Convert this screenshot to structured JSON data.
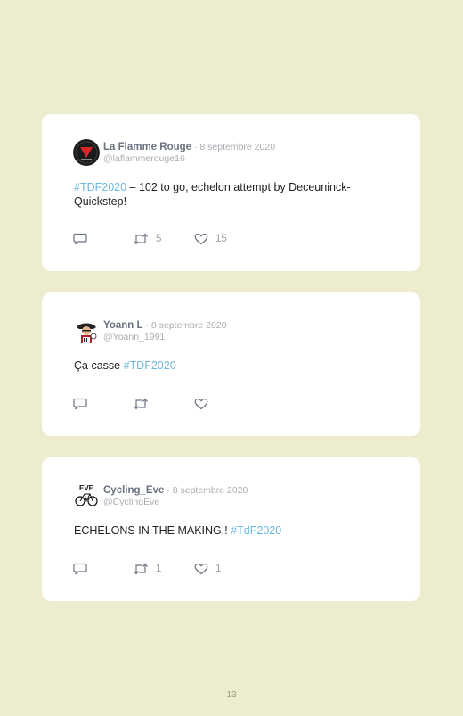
{
  "tweets": [
    {
      "name": "La Flamme Rouge",
      "date": " · 8 septembre 2020",
      "handle": "@laflammerouge16",
      "avatar_icon": "flamme-rouge-logo",
      "text_parts": [
        {
          "text": "#TDF2020",
          "hashtag": true
        },
        {
          "text": " – 102 to go, echelon attempt by Deceuninck-Quickstep!",
          "hashtag": false
        }
      ],
      "retweets": "5",
      "likes": "15"
    },
    {
      "name": "Yoann L",
      "date": " · 8 septembre 2020",
      "handle": "@Yoann_1991",
      "avatar_icon": "pirate-avatar",
      "text_parts": [
        {
          "text": "Ça casse ",
          "hashtag": false
        },
        {
          "text": "#TDF2020",
          "hashtag": true
        }
      ],
      "retweets": "",
      "likes": ""
    },
    {
      "name": "Cycling_Eve",
      "date": " · 8 septembre 2020",
      "handle": "@CyclingEve",
      "avatar_icon": "eve-bike-logo",
      "avatar_text": "EVE",
      "text_parts": [
        {
          "text": "ECHELONS IN THE MAKING!! ",
          "hashtag": false
        },
        {
          "text": "#TdF2020",
          "hashtag": true
        }
      ],
      "retweets": "1",
      "likes": "1"
    }
  ],
  "page_number": "13",
  "colors": {
    "background": "#eeeccf",
    "card": "#ffffff",
    "hashtag": "#6fb8dd",
    "name": "#6b7280",
    "muted": "#a9adb3"
  }
}
